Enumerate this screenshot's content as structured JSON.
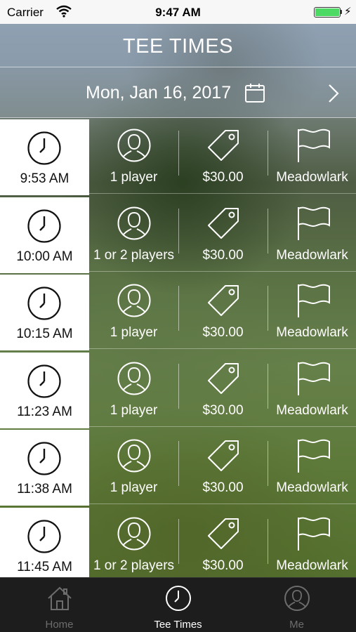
{
  "status_bar": {
    "carrier": "Carrier",
    "time": "9:47 AM",
    "battery_color": "#4cd964"
  },
  "header": {
    "title": "TEE TIMES",
    "date": "Mon, Jan 16, 2017",
    "calendar_icon": "calendar-icon",
    "next_icon": "chevron-right-icon"
  },
  "tee_times": [
    {
      "time": "9:53 AM",
      "players": "1 player",
      "price": "$30.00",
      "course": "Meadowlark"
    },
    {
      "time": "10:00 AM",
      "players": "1 or 2 players",
      "price": "$30.00",
      "course": "Meadowlark"
    },
    {
      "time": "10:15 AM",
      "players": "1 player",
      "price": "$30.00",
      "course": "Meadowlark"
    },
    {
      "time": "11:23 AM",
      "players": "1 player",
      "price": "$30.00",
      "course": "Meadowlark"
    },
    {
      "time": "11:38 AM",
      "players": "1 player",
      "price": "$30.00",
      "course": "Meadowlark"
    },
    {
      "time": "11:45 AM",
      "players": "1 or 2 players",
      "price": "$30.00",
      "course": "Meadowlark"
    }
  ],
  "tab_bar": {
    "tabs": [
      {
        "label": "Home",
        "icon": "home-icon",
        "active": false
      },
      {
        "label": "Tee Times",
        "icon": "clock-icon",
        "active": true
      },
      {
        "label": "Me",
        "icon": "user-icon",
        "active": false
      }
    ],
    "active_color": "#ffffff",
    "inactive_color": "#6d6d6d"
  }
}
